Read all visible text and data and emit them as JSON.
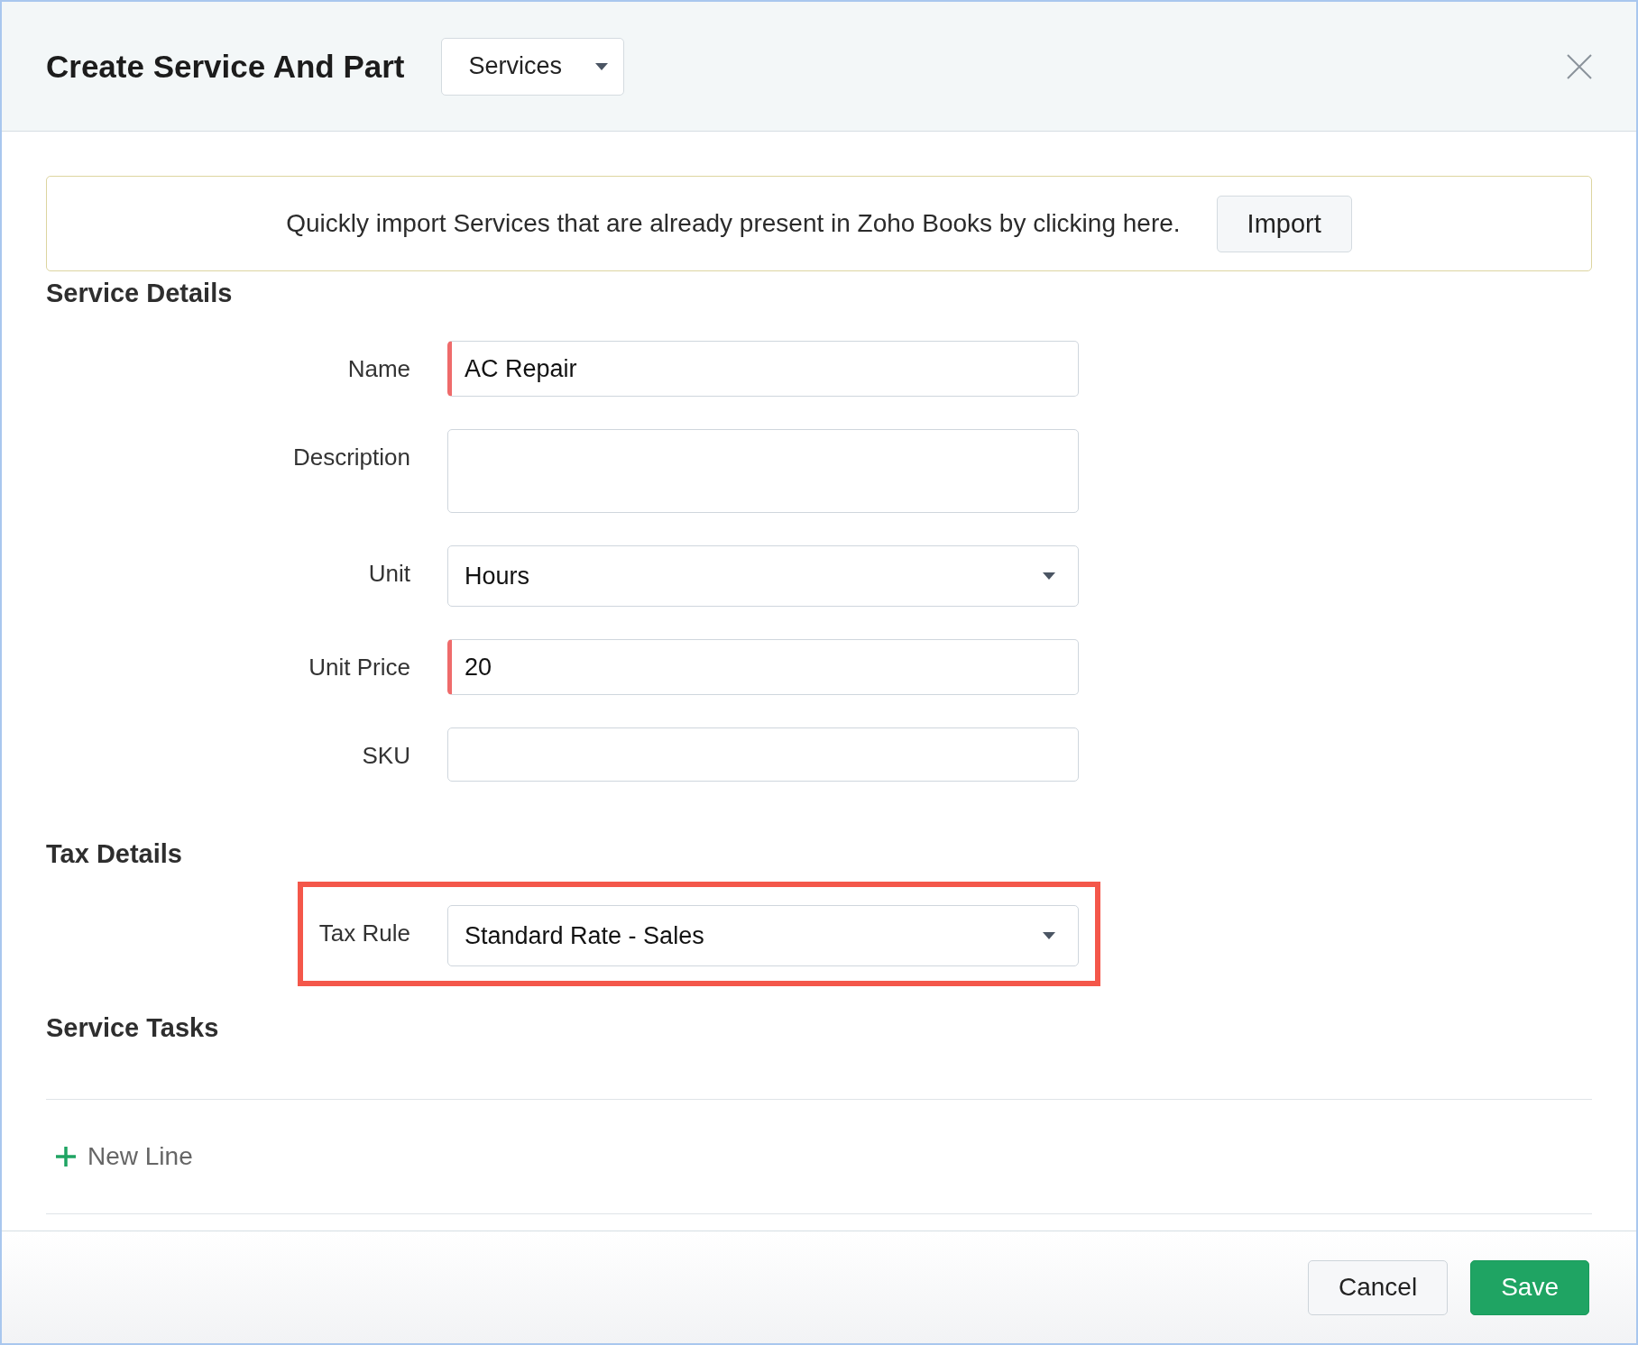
{
  "dialog": {
    "title": "Create Service And Part",
    "type_select": {
      "value": "Services"
    }
  },
  "banner": {
    "message": "Quickly import Services that are already present in Zoho Books by clicking here.",
    "button": "Import"
  },
  "sections": [
    {
      "title": "Service Details",
      "fields": [
        {
          "label": "Name",
          "kind": "text",
          "value": "AC Repair",
          "required": true,
          "highlighted": false
        },
        {
          "label": "Description",
          "kind": "textarea",
          "required": false,
          "highlighted": false
        },
        {
          "label": "Unit",
          "kind": "select",
          "value": "Hours",
          "required": false,
          "highlighted": false
        },
        {
          "label": "Unit Price",
          "kind": "text",
          "value": "20",
          "required": true,
          "highlighted": false
        },
        {
          "label": "SKU",
          "kind": "text",
          "required": false,
          "highlighted": false
        }
      ]
    },
    {
      "title": "Tax Details",
      "fields": [
        {
          "label": "Tax Rule",
          "kind": "select",
          "value": "Standard Rate - Sales",
          "required": false,
          "highlighted": true
        }
      ]
    },
    {
      "title": "Service Tasks",
      "add_link": "New Line"
    }
  ],
  "footer": {
    "buttons": [
      {
        "label": "Cancel",
        "kind": "secondary"
      },
      {
        "label": "Save",
        "kind": "primary"
      }
    ]
  }
}
